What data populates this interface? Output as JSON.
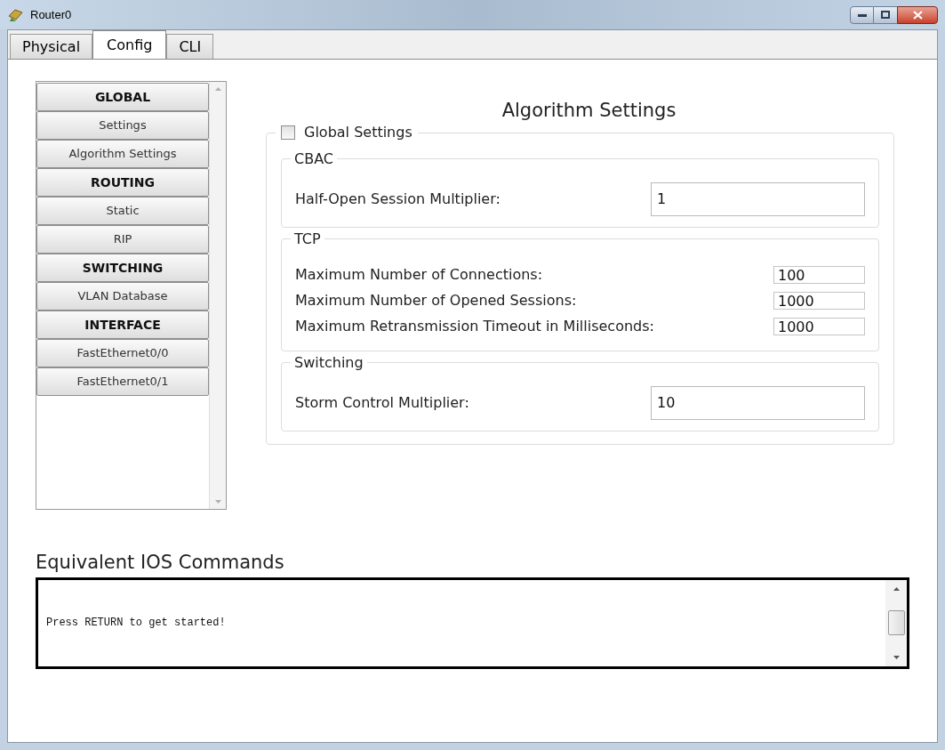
{
  "window": {
    "title": "Router0"
  },
  "tabs": [
    {
      "label": "Physical",
      "selected": false
    },
    {
      "label": "Config",
      "selected": true
    },
    {
      "label": "CLI",
      "selected": false
    }
  ],
  "sidebar": {
    "items": [
      {
        "label": "GLOBAL",
        "kind": "header"
      },
      {
        "label": "Settings",
        "kind": "item"
      },
      {
        "label": "Algorithm Settings",
        "kind": "item"
      },
      {
        "label": "ROUTING",
        "kind": "header"
      },
      {
        "label": "Static",
        "kind": "item"
      },
      {
        "label": "RIP",
        "kind": "item"
      },
      {
        "label": "SWITCHING",
        "kind": "header"
      },
      {
        "label": "VLAN Database",
        "kind": "item"
      },
      {
        "label": "INTERFACE",
        "kind": "header"
      },
      {
        "label": "FastEthernet0/0",
        "kind": "item"
      },
      {
        "label": "FastEthernet0/1",
        "kind": "item"
      }
    ]
  },
  "panel": {
    "title": "Algorithm Settings",
    "global_settings": {
      "label": "Global Settings",
      "checked": false
    },
    "groups": [
      {
        "title": "CBAC",
        "fields": [
          {
            "label": "Half-Open Session Multiplier:",
            "value": "1",
            "kind": "wide"
          }
        ]
      },
      {
        "title": "TCP",
        "fields": [
          {
            "label": "Maximum Number of Connections:",
            "value": "100",
            "kind": "narrow"
          },
          {
            "label": "Maximum Number of Opened Sessions:",
            "value": "1000",
            "kind": "narrow"
          },
          {
            "label": "Maximum Retransmission Timeout in Milliseconds:",
            "value": "1000",
            "kind": "narrow"
          }
        ]
      },
      {
        "title": "Switching",
        "fields": [
          {
            "label": "Storm Control Multiplier:",
            "value": "10",
            "kind": "wide"
          }
        ]
      }
    ]
  },
  "ios_commands": {
    "title": "Equivalent IOS Commands",
    "text": "Press RETURN to get started!"
  }
}
